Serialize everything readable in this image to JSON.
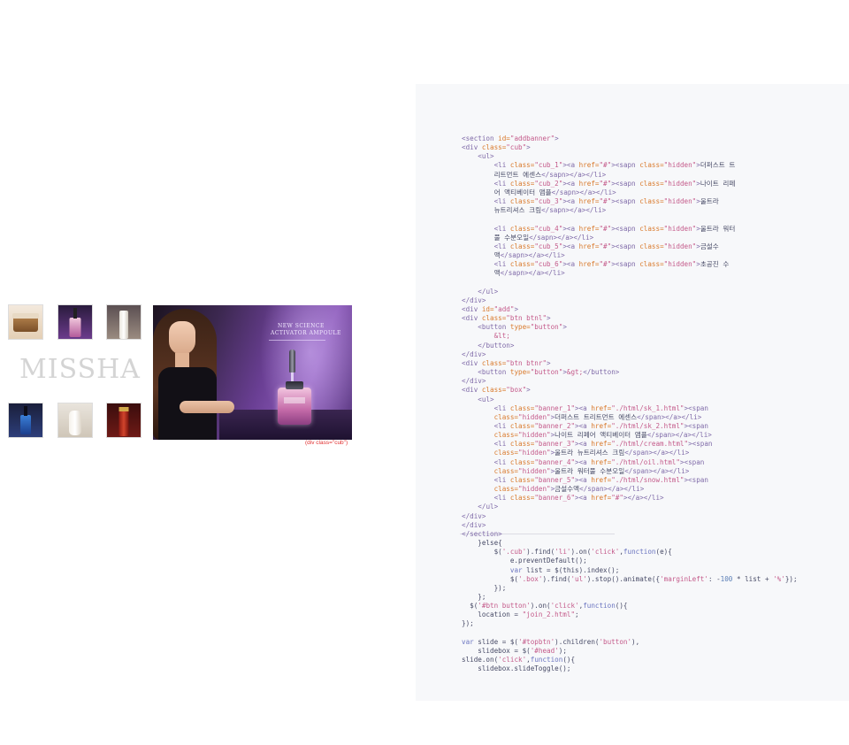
{
  "brand": {
    "logo_text": "MISSHA"
  },
  "banner": {
    "product_line1": "NEW SCIENCE",
    "product_line2": "ACTIVATOR AMPOULE",
    "caption": "(div class=\"cub\")"
  },
  "code": {
    "lines": [
      [
        [
          "t",
          "<section "
        ],
        [
          "a",
          "id="
        ],
        [
          "s",
          "\"addbanner\""
        ],
        [
          "t",
          ">"
        ]
      ],
      [
        [
          "t",
          "<div "
        ],
        [
          "a",
          "class="
        ],
        [
          "s",
          "\"cub\""
        ],
        [
          "t",
          ">"
        ]
      ],
      [
        [
          "x",
          "    "
        ],
        [
          "t",
          "<ul>"
        ]
      ],
      [
        [
          "x",
          "        "
        ],
        [
          "t",
          "<li "
        ],
        [
          "a",
          "class="
        ],
        [
          "s",
          "\"cub_1\""
        ],
        [
          "t",
          "><a "
        ],
        [
          "a",
          "href="
        ],
        [
          "s",
          "\"#\""
        ],
        [
          "t",
          "><sapn "
        ],
        [
          "a",
          "class="
        ],
        [
          "s",
          "\"hidden\""
        ],
        [
          "t",
          ">"
        ],
        [
          "x",
          "더퍼스트 트"
        ]
      ],
      [
        [
          "x",
          "        리트먼트 에센스"
        ],
        [
          "t",
          "</sapn></a></li>"
        ]
      ],
      [
        [
          "x",
          "        "
        ],
        [
          "t",
          "<li "
        ],
        [
          "a",
          "class="
        ],
        [
          "s",
          "\"cub_2\""
        ],
        [
          "t",
          "><a "
        ],
        [
          "a",
          "href="
        ],
        [
          "s",
          "\"#\""
        ],
        [
          "t",
          "><sapn "
        ],
        [
          "a",
          "class="
        ],
        [
          "s",
          "\"hidden\""
        ],
        [
          "t",
          ">"
        ],
        [
          "x",
          "나이트 리페"
        ]
      ],
      [
        [
          "x",
          "        어 액티베이터 앰플"
        ],
        [
          "t",
          "</sapn></a></li>"
        ]
      ],
      [
        [
          "x",
          "        "
        ],
        [
          "t",
          "<li "
        ],
        [
          "a",
          "class="
        ],
        [
          "s",
          "\"cub_3\""
        ],
        [
          "t",
          "><a "
        ],
        [
          "a",
          "href="
        ],
        [
          "s",
          "\"#\""
        ],
        [
          "t",
          "><sapn "
        ],
        [
          "a",
          "class="
        ],
        [
          "s",
          "\"hidden\""
        ],
        [
          "t",
          ">"
        ],
        [
          "x",
          "울트라"
        ]
      ],
      [
        [
          "x",
          "        뉴트리셔스 크림"
        ],
        [
          "t",
          "</sapn></a></li>"
        ]
      ],
      [
        [
          "x",
          ""
        ]
      ],
      [
        [
          "x",
          "        "
        ],
        [
          "t",
          "<li "
        ],
        [
          "a",
          "class="
        ],
        [
          "s",
          "\"cub_4\""
        ],
        [
          "t",
          "><a "
        ],
        [
          "a",
          "href="
        ],
        [
          "s",
          "\"#\""
        ],
        [
          "t",
          "><sapn "
        ],
        [
          "a",
          "class="
        ],
        [
          "s",
          "\"hidden\""
        ],
        [
          "t",
          ">"
        ],
        [
          "x",
          "울트라 워터"
        ]
      ],
      [
        [
          "x",
          "        풀 수분오일"
        ],
        [
          "t",
          "</sapn></a></li>"
        ]
      ],
      [
        [
          "x",
          "        "
        ],
        [
          "t",
          "<li "
        ],
        [
          "a",
          "class="
        ],
        [
          "s",
          "\"cub_5\""
        ],
        [
          "t",
          "><a "
        ],
        [
          "a",
          "href="
        ],
        [
          "s",
          "\"#\""
        ],
        [
          "t",
          "><sapn "
        ],
        [
          "a",
          "class="
        ],
        [
          "s",
          "\"hidden\""
        ],
        [
          "t",
          ">"
        ],
        [
          "x",
          "금설수"
        ]
      ],
      [
        [
          "x",
          "        액"
        ],
        [
          "t",
          "</sapn></a></li>"
        ]
      ],
      [
        [
          "x",
          "        "
        ],
        [
          "t",
          "<li "
        ],
        [
          "a",
          "class="
        ],
        [
          "s",
          "\"cub_6\""
        ],
        [
          "t",
          "><a "
        ],
        [
          "a",
          "href="
        ],
        [
          "s",
          "\"#\""
        ],
        [
          "t",
          "><sapn "
        ],
        [
          "a",
          "class="
        ],
        [
          "s",
          "\"hidden\""
        ],
        [
          "t",
          ">"
        ],
        [
          "x",
          "초공진 수"
        ]
      ],
      [
        [
          "x",
          "        액"
        ],
        [
          "t",
          "</sapn></a></li>"
        ]
      ],
      [
        [
          "x",
          ""
        ]
      ],
      [
        [
          "x",
          "    "
        ],
        [
          "t",
          "</ul>"
        ]
      ],
      [
        [
          "t",
          "</div>"
        ]
      ],
      [
        [
          "t",
          "<div "
        ],
        [
          "a",
          "id="
        ],
        [
          "s",
          "\"add\""
        ],
        [
          "t",
          ">"
        ]
      ],
      [
        [
          "t",
          "<div "
        ],
        [
          "a",
          "class="
        ],
        [
          "s",
          "\"btn btnl\""
        ],
        [
          "t",
          ">"
        ]
      ],
      [
        [
          "x",
          "    "
        ],
        [
          "t",
          "<button "
        ],
        [
          "a",
          "type="
        ],
        [
          "s",
          "\"button\""
        ],
        [
          "t",
          ">"
        ]
      ],
      [
        [
          "x",
          "        "
        ],
        [
          "s",
          "&lt;"
        ]
      ],
      [
        [
          "x",
          "    "
        ],
        [
          "t",
          "</button>"
        ]
      ],
      [
        [
          "t",
          "</div>"
        ]
      ],
      [
        [
          "t",
          "<div "
        ],
        [
          "a",
          "class="
        ],
        [
          "s",
          "\"btn btnr\""
        ],
        [
          "t",
          ">"
        ]
      ],
      [
        [
          "x",
          "    "
        ],
        [
          "t",
          "<button "
        ],
        [
          "a",
          "type="
        ],
        [
          "s",
          "\"button\""
        ],
        [
          "t",
          ">"
        ],
        [
          "s",
          "&gt;"
        ],
        [
          "t",
          "</button>"
        ]
      ],
      [
        [
          "t",
          "</div>"
        ]
      ],
      [
        [
          "t",
          "<div "
        ],
        [
          "a",
          "class="
        ],
        [
          "s",
          "\"box\""
        ],
        [
          "t",
          ">"
        ]
      ],
      [
        [
          "x",
          "    "
        ],
        [
          "t",
          "<ul>"
        ]
      ],
      [
        [
          "x",
          "        "
        ],
        [
          "t",
          "<li "
        ],
        [
          "a",
          "class="
        ],
        [
          "s",
          "\"banner_1\""
        ],
        [
          "t",
          "><a "
        ],
        [
          "a",
          "href="
        ],
        [
          "s",
          "\"./html/sk_1.html\""
        ],
        [
          "t",
          "><span"
        ]
      ],
      [
        [
          "x",
          "        "
        ],
        [
          "a",
          "class="
        ],
        [
          "s",
          "\"hidden\""
        ],
        [
          "t",
          ">"
        ],
        [
          "x",
          "더퍼스트 트리트먼트 에센스"
        ],
        [
          "t",
          "</span></a></li>"
        ]
      ],
      [
        [
          "x",
          "        "
        ],
        [
          "t",
          "<li "
        ],
        [
          "a",
          "class="
        ],
        [
          "s",
          "\"banner_2\""
        ],
        [
          "t",
          "><a "
        ],
        [
          "a",
          "href="
        ],
        [
          "s",
          "\"./html/sk_2.html\""
        ],
        [
          "t",
          "><span"
        ]
      ],
      [
        [
          "x",
          "        "
        ],
        [
          "a",
          "class="
        ],
        [
          "s",
          "\"hidden\""
        ],
        [
          "t",
          ">"
        ],
        [
          "x",
          "나이트 리페어 액티베이터 앰플"
        ],
        [
          "t",
          "</span></a></li>"
        ]
      ],
      [
        [
          "x",
          "        "
        ],
        [
          "t",
          "<li "
        ],
        [
          "a",
          "class="
        ],
        [
          "s",
          "\"banner_3\""
        ],
        [
          "t",
          "><a "
        ],
        [
          "a",
          "href="
        ],
        [
          "s",
          "\"./html/cream.html\""
        ],
        [
          "t",
          "><span"
        ]
      ],
      [
        [
          "x",
          "        "
        ],
        [
          "a",
          "class="
        ],
        [
          "s",
          "\"hidden\""
        ],
        [
          "t",
          ">"
        ],
        [
          "x",
          "울트라 뉴트리셔스 크림"
        ],
        [
          "t",
          "</span></a></li>"
        ]
      ],
      [
        [
          "x",
          "        "
        ],
        [
          "t",
          "<li "
        ],
        [
          "a",
          "class="
        ],
        [
          "s",
          "\"banner_4\""
        ],
        [
          "t",
          "><a "
        ],
        [
          "a",
          "href="
        ],
        [
          "s",
          "\"./html/oil.html\""
        ],
        [
          "t",
          "><span"
        ]
      ],
      [
        [
          "x",
          "        "
        ],
        [
          "a",
          "class="
        ],
        [
          "s",
          "\"hidden\""
        ],
        [
          "t",
          ">"
        ],
        [
          "x",
          "울트라 워터풀 수분오일"
        ],
        [
          "t",
          "</span></a></li>"
        ]
      ],
      [
        [
          "x",
          "        "
        ],
        [
          "t",
          "<li "
        ],
        [
          "a",
          "class="
        ],
        [
          "s",
          "\"banner_5\""
        ],
        [
          "t",
          "><a "
        ],
        [
          "a",
          "href="
        ],
        [
          "s",
          "\"./html/snow.html\""
        ],
        [
          "t",
          "><span"
        ]
      ],
      [
        [
          "x",
          "        "
        ],
        [
          "a",
          "class="
        ],
        [
          "s",
          "\"hidden\""
        ],
        [
          "t",
          ">"
        ],
        [
          "x",
          "금설수액"
        ],
        [
          "t",
          "</span></a></li>"
        ]
      ],
      [
        [
          "x",
          "        "
        ],
        [
          "t",
          "<li "
        ],
        [
          "a",
          "class="
        ],
        [
          "s",
          "\"banner_6\""
        ],
        [
          "t",
          "><a "
        ],
        [
          "a",
          "href="
        ],
        [
          "s",
          "\"#\""
        ],
        [
          "t",
          "></a></li>"
        ]
      ],
      [
        [
          "x",
          "    "
        ],
        [
          "t",
          "</ul>"
        ]
      ],
      [
        [
          "t",
          "</div>"
        ]
      ],
      [
        [
          "t",
          "</div>"
        ]
      ],
      [
        [
          "t",
          "</section>"
        ]
      ],
      [
        [
          "x",
          "    }else{"
        ]
      ],
      [
        [
          "x",
          "        $("
        ],
        [
          "s",
          "'.cub'"
        ],
        [
          "x",
          ").find("
        ],
        [
          "s",
          "'li'"
        ],
        [
          "x",
          ").on("
        ],
        [
          "s",
          "'click'"
        ],
        [
          "x",
          ","
        ],
        [
          "k",
          "function"
        ],
        [
          "x",
          "(e){"
        ]
      ],
      [
        [
          "x",
          "            e.preventDefault();"
        ]
      ],
      [
        [
          "x",
          "            "
        ],
        [
          "k",
          "var"
        ],
        [
          "x",
          " list = $(this).index();"
        ]
      ],
      [
        [
          "x",
          "            $("
        ],
        [
          "s",
          "'.box'"
        ],
        [
          "x",
          ").find("
        ],
        [
          "s",
          "'ul'"
        ],
        [
          "x",
          ").stop().animate({"
        ],
        [
          "s",
          "'marginLeft'"
        ],
        [
          "x",
          ": -"
        ],
        [
          "v",
          "100"
        ],
        [
          "x",
          " * list + "
        ],
        [
          "s",
          "'%'"
        ],
        [
          "x",
          "});"
        ]
      ],
      [
        [
          "x",
          "        });"
        ]
      ],
      [
        [
          "x",
          "    };"
        ]
      ],
      [
        [
          "x",
          "  $("
        ],
        [
          "s",
          "'#btn button'"
        ],
        [
          "x",
          ").on("
        ],
        [
          "s",
          "'click'"
        ],
        [
          "x",
          ","
        ],
        [
          "k",
          "function"
        ],
        [
          "x",
          "(){"
        ]
      ],
      [
        [
          "x",
          "    location = "
        ],
        [
          "s",
          "\"join_2.html\""
        ],
        [
          "x",
          ";"
        ]
      ],
      [
        [
          "x",
          "});"
        ]
      ],
      [
        [
          "x",
          ""
        ]
      ],
      [
        [
          "k",
          "var"
        ],
        [
          "x",
          " slide = $("
        ],
        [
          "s",
          "'#topbtn'"
        ],
        [
          "x",
          ").children("
        ],
        [
          "s",
          "'button'"
        ],
        [
          "x",
          "),"
        ]
      ],
      [
        [
          "x",
          "    slidebox = $("
        ],
        [
          "s",
          "'#head'"
        ],
        [
          "x",
          ");"
        ]
      ],
      [
        [
          "x",
          "slide.on("
        ],
        [
          "s",
          "'click'"
        ],
        [
          "x",
          ","
        ],
        [
          "k",
          "function"
        ],
        [
          "x",
          "(){"
        ]
      ],
      [
        [
          "x",
          "    slidebox.slideToggle();"
        ]
      ]
    ]
  }
}
